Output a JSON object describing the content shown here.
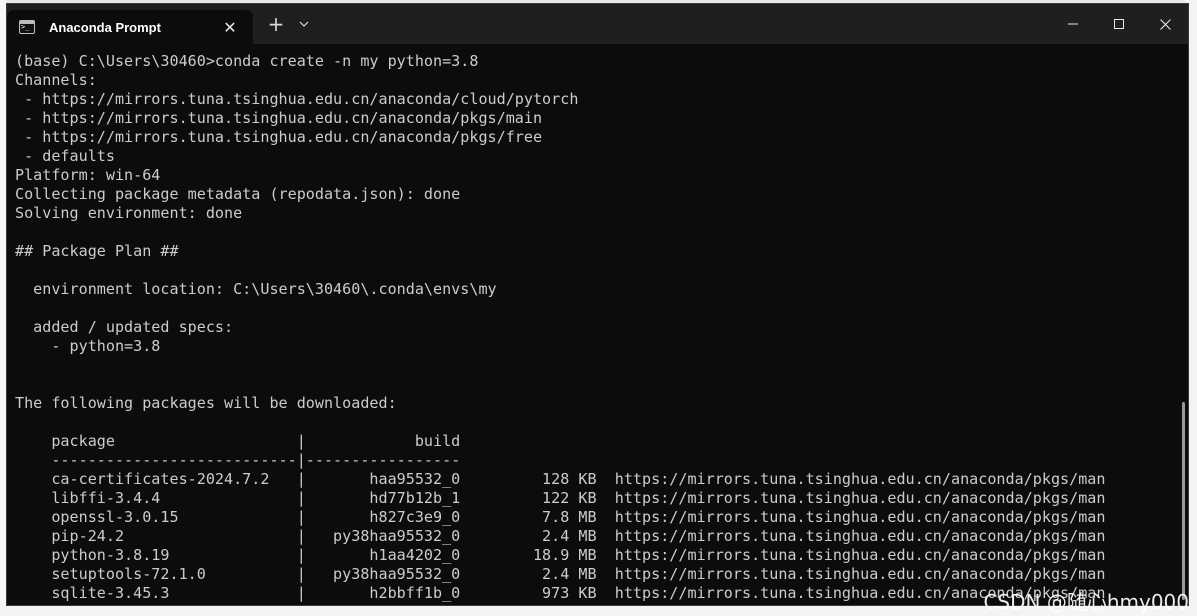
{
  "window": {
    "tab_title": "Anaconda Prompt",
    "tab_close": "✕",
    "new_tab": "+",
    "dropdown": "⌄",
    "icons": {
      "app": "terminal-icon",
      "minimize": "minimize-icon",
      "maximize": "maximize-icon",
      "close": "close-icon"
    }
  },
  "terminal": {
    "lines": [
      "(base) C:\\Users\\30460>conda create -n my python=3.8",
      "Channels:",
      " - https://mirrors.tuna.tsinghua.edu.cn/anaconda/cloud/pytorch",
      " - https://mirrors.tuna.tsinghua.edu.cn/anaconda/pkgs/main",
      " - https://mirrors.tuna.tsinghua.edu.cn/anaconda/pkgs/free",
      " - defaults",
      "Platform: win-64",
      "Collecting package metadata (repodata.json): done",
      "Solving environment: done",
      "",
      "## Package Plan ##",
      "",
      "  environment location: C:\\Users\\30460\\.conda\\envs\\my",
      "",
      "  added / updated specs:",
      "    - python=3.8",
      "",
      "",
      "The following packages will be downloaded:",
      "",
      "    package                    |            build",
      "    ---------------------------|-----------------",
      "    ca-certificates-2024.7.2   |       haa95532_0         128 KB  https://mirrors.tuna.tsinghua.edu.cn/anaconda/pkgs/man",
      "    libffi-3.4.4               |       hd77b12b_1         122 KB  https://mirrors.tuna.tsinghua.edu.cn/anaconda/pkgs/man",
      "    openssl-3.0.15             |       h827c3e9_0         7.8 MB  https://mirrors.tuna.tsinghua.edu.cn/anaconda/pkgs/man",
      "    pip-24.2                   |   py38haa95532_0         2.4 MB  https://mirrors.tuna.tsinghua.edu.cn/anaconda/pkgs/man",
      "    python-3.8.19              |       h1aa4202_0        18.9 MB  https://mirrors.tuna.tsinghua.edu.cn/anaconda/pkgs/man",
      "    setuptools-72.1.0          |   py38haa95532_0         2.4 MB  https://mirrors.tuna.tsinghua.edu.cn/anaconda/pkgs/man",
      "    sqlite-3.45.3              |       h2bbff1b_0         973 KB  https://mirrors.tuna.tsinghua.edu.cn/anaconda/pkgs/man"
    ]
  },
  "watermark": "CSDN @随心hmy000"
}
